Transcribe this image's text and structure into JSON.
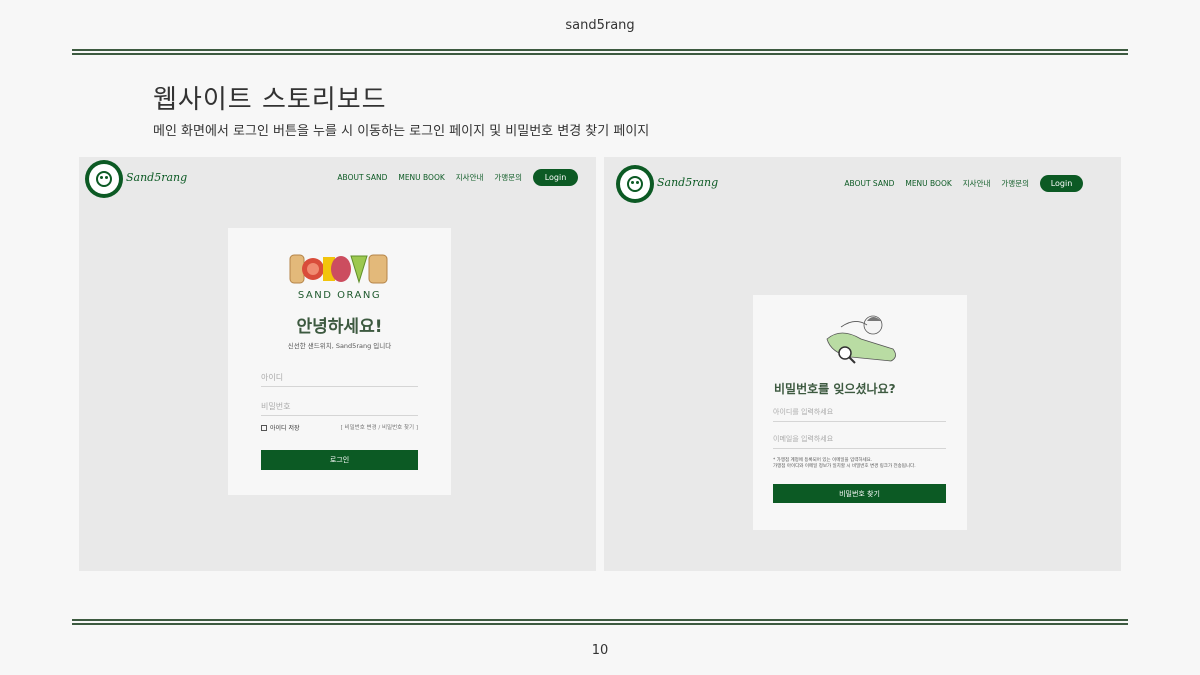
{
  "slide": {
    "header_title": "sand5rang",
    "heading": "웹사이트 스토리보드",
    "description": "메인 화면에서 로그인 버튼을 누를 시 이동하는 로그인 페이지 및 비밀번호 변경 찾기 페이지",
    "page_number": "10"
  },
  "site": {
    "brand": "Sand5rang",
    "nav": [
      "ABOUT SAND",
      "MENU BOOK",
      "지사안내",
      "가맹문의"
    ],
    "login_button": "Login"
  },
  "login_page": {
    "brand_wordmark": "SAND ORANG",
    "welcome": "안녕하세요!",
    "welcome_sub": "신선한 샌드위치, Sand5rang 입니다",
    "id_placeholder": "아이디",
    "pw_placeholder": "비밀번호",
    "remember_label": "아이디 저장",
    "find_link": "[ 비밀번호 변경 / 비밀번호 찾기 ]",
    "submit": "로그인"
  },
  "forgot_page": {
    "title": "비밀번호를 잊으셨나요?",
    "id_placeholder": "아이디를 입력하세요",
    "email_placeholder": "이메일을 입력하세요",
    "notice_line1": "* 가맹점 계정에 등록되어 있는 이메일을 입력하세요.",
    "notice_line2": "가맹점 아이디와 이메일 정보가 일치할 시 비밀번호 변경 링크가 전송됩니다.",
    "submit": "비밀번호 찾기"
  },
  "colors": {
    "brand_green": "#0c5a24",
    "rule_green": "#3d5a40",
    "canvas_gray": "#e9e9e9"
  }
}
